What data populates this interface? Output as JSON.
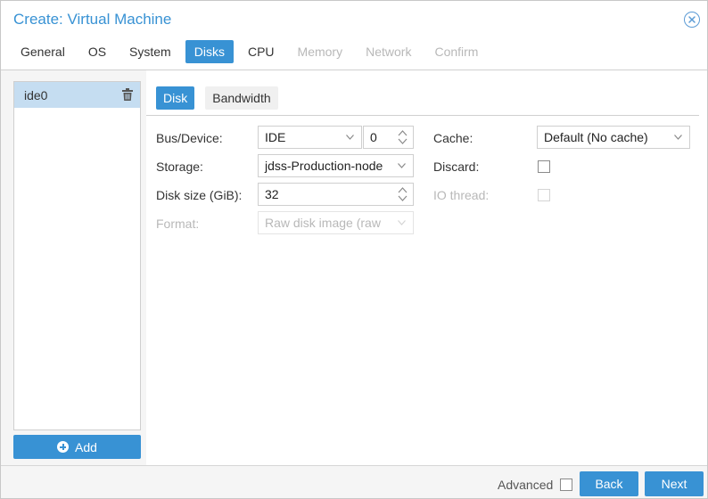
{
  "window": {
    "title": "Create: Virtual Machine",
    "close_icon": "close-circle-icon"
  },
  "tabs": [
    {
      "label": "General",
      "state": "normal"
    },
    {
      "label": "OS",
      "state": "normal"
    },
    {
      "label": "System",
      "state": "normal"
    },
    {
      "label": "Disks",
      "state": "active"
    },
    {
      "label": "CPU",
      "state": "normal"
    },
    {
      "label": "Memory",
      "state": "disabled"
    },
    {
      "label": "Network",
      "state": "disabled"
    },
    {
      "label": "Confirm",
      "state": "disabled"
    }
  ],
  "disk_list": {
    "items": [
      {
        "label": "ide0",
        "selected": true,
        "delete_icon": "trash-icon"
      }
    ],
    "add_button": {
      "label": "Add",
      "icon": "plus-circle-icon"
    }
  },
  "subtabs": [
    {
      "label": "Disk",
      "active": true
    },
    {
      "label": "Bandwidth",
      "active": false
    }
  ],
  "form": {
    "bus_device": {
      "label": "Bus/Device:",
      "bus_value": "IDE",
      "device_value": "0"
    },
    "storage": {
      "label": "Storage:",
      "value": "jdss-Production-node"
    },
    "disk_size": {
      "label": "Disk size (GiB):",
      "value": "32"
    },
    "format": {
      "label": "Format:",
      "value": "Raw disk image (raw",
      "disabled": true
    },
    "cache": {
      "label": "Cache:",
      "value": "Default (No cache)"
    },
    "discard": {
      "label": "Discard:",
      "checked": false
    },
    "io_thread": {
      "label": "IO thread:",
      "checked": false,
      "disabled": true
    }
  },
  "footer": {
    "advanced_label": "Advanced",
    "advanced_checked": false,
    "back_label": "Back",
    "next_label": "Next"
  },
  "colors": {
    "accent": "#3892d4",
    "selected_row": "#c5ddf1",
    "disabled_text": "#b8b8b8"
  }
}
